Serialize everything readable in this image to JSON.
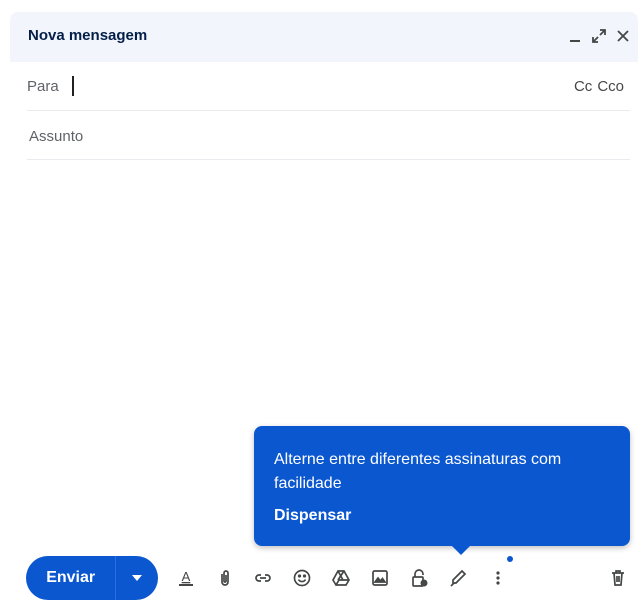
{
  "header": {
    "title": "Nova mensagem"
  },
  "to": {
    "label": "Para",
    "cc": "Cc",
    "bcc": "Cco"
  },
  "subject": {
    "placeholder": "Assunto"
  },
  "tooltip": {
    "message": "Alterne entre diferentes assinaturas com facilidade",
    "dismiss": "Dispensar"
  },
  "toolbar": {
    "send_label": "Enviar",
    "icons": [
      "formatting-icon",
      "attach-icon",
      "link-icon",
      "emoji-icon",
      "drive-icon",
      "photo-icon",
      "confidential-icon",
      "signature-icon",
      "more-options-icon",
      "delete-icon"
    ]
  },
  "colors": {
    "accent": "#0b57d0",
    "header_bg": "#f2f6fc"
  }
}
